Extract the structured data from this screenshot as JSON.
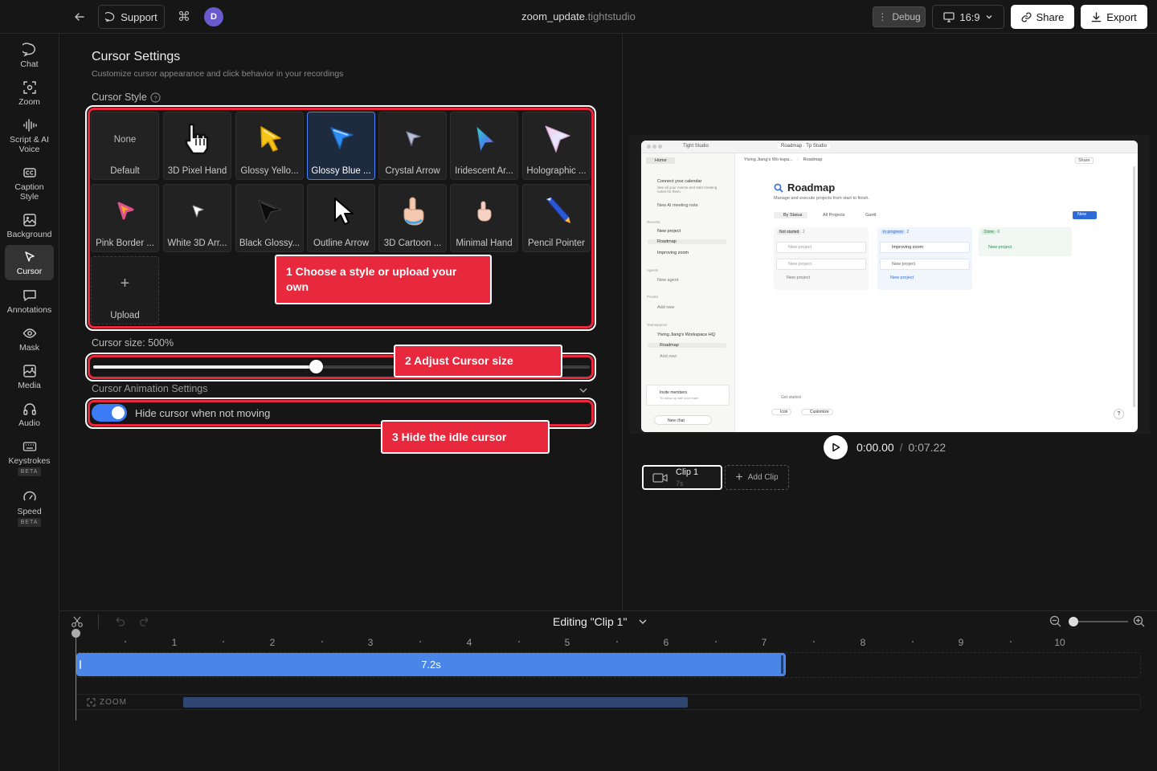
{
  "topbar": {
    "support_label": "Support",
    "avatar_letter": "D",
    "file_name": "zoom_update",
    "file_ext": ".tightstudio",
    "debug_label": "Debug",
    "ratio_label": "16:9",
    "share_label": "Share",
    "export_label": "Export"
  },
  "sidebar": {
    "items": [
      {
        "label": "Chat",
        "icon": "chat-bubble-icon"
      },
      {
        "label": "Zoom",
        "icon": "zoom-frame-icon"
      },
      {
        "label": "Script & AI Voice",
        "icon": "waveform-icon"
      },
      {
        "label": "Caption Style",
        "icon": "caption-icon"
      },
      {
        "label": "Background",
        "icon": "image-icon"
      },
      {
        "label": "Cursor",
        "icon": "cursor-icon",
        "active": true
      },
      {
        "label": "Annotations",
        "icon": "annotation-icon"
      },
      {
        "label": "Mask",
        "icon": "eye-icon"
      },
      {
        "label": "Media",
        "icon": "media-icon"
      },
      {
        "label": "Audio",
        "icon": "headphones-icon"
      },
      {
        "label": "Keystrokes",
        "icon": "keyboard-icon",
        "badge": "BETA"
      },
      {
        "label": "Speed",
        "icon": "gauge-icon",
        "badge": "BETA"
      }
    ]
  },
  "cursor_settings": {
    "title": "Cursor Settings",
    "subtitle": "Customize cursor appearance and click behavior in your recordings",
    "style_label": "Cursor Style",
    "none_text": "None",
    "styles": [
      {
        "label": "Default"
      },
      {
        "label": "3D Pixel Hand"
      },
      {
        "label": "Glossy Yello..."
      },
      {
        "label": "Glossy Blue ...",
        "selected": true
      },
      {
        "label": "Crystal Arrow"
      },
      {
        "label": "Iridescent Ar..."
      },
      {
        "label": "Holographic ..."
      },
      {
        "label": "Pink Border ..."
      },
      {
        "label": "White 3D Arr..."
      },
      {
        "label": "Black Glossy..."
      },
      {
        "label": "Outline Arrow"
      },
      {
        "label": "3D Cartoon ..."
      },
      {
        "label": "Minimal Hand"
      },
      {
        "label": "Pencil Pointer"
      },
      {
        "label": "Upload"
      }
    ],
    "size_label": "Cursor size: 500%",
    "size_fraction": 0.448,
    "animation_label": "Cursor Animation Settings",
    "hide_toggle_label": "Hide cursor when not moving",
    "hide_toggle_on": true
  },
  "callouts": {
    "c1": "1 Choose a style or upload your own",
    "c2": "2 Adjust Cursor size",
    "c3": "3 Hide the idle cursor"
  },
  "preview": {
    "app_name": "Tight Studio",
    "home_label": "Home",
    "tab_roadmap": "Roadmap · Tp Studio",
    "breadcrumb_ws": "Yiving Jiang's Wo kspa...",
    "breadcrumb_page": "Roadmap",
    "share_label": "Share",
    "calendar_title": "Connect your calendar",
    "calendar_desc": "See all your events and start meeting notes for them.",
    "new_meeting": "New AI meeting note",
    "recents_label": "Recents",
    "recents": [
      "New project",
      "Roadmap",
      "Improving zoom"
    ],
    "agents_label": "Agents",
    "new_agent": "New agent",
    "private_label": "Private",
    "add_new": "Add new",
    "teamspaces_label": "Teamspaces",
    "workspace_hq": "Yiving Jiang's Workspace HQ",
    "teamspace_roadmap": "Roadmap",
    "teamspace_add": "Add new",
    "invite_title": "Invite members",
    "invite_desc": "To follow up with your team",
    "new_chat": "New chat",
    "page_title": "Roadmap",
    "page_desc": "Manage and execute projects from start to finish.",
    "view_by_status": "By Status",
    "view_all": "All Projects",
    "view_gantt": "Gantt",
    "new_button": "New",
    "columns": [
      {
        "name": "Not started",
        "count": "2",
        "cards": [
          "New project",
          "New project"
        ],
        "add": "New project"
      },
      {
        "name": "In progress",
        "count": "2",
        "cards": [
          "Improving zoom",
          "New project"
        ],
        "add": "New project"
      },
      {
        "name": "Done",
        "count": "0",
        "cards": [],
        "add": "New project"
      }
    ],
    "get_started": "Get started",
    "footer_left": "Icon",
    "footer_right": "Customize"
  },
  "player": {
    "current_time": "0:00.00",
    "separator": "/",
    "total_time": "0:07.22",
    "clip_name": "Clip 1",
    "clip_duration": "7s",
    "add_clip_label": "Add Clip"
  },
  "timeline": {
    "editing_label": "Editing \"Clip 1\"",
    "ticks": [
      "1",
      "2",
      "3",
      "4",
      "5",
      "6",
      "7",
      "8",
      "9",
      "10"
    ],
    "clip_length_label": "7.2s",
    "zoom_track_label": "ZOOM",
    "zoom_level_fraction": 0.0
  },
  "colors": {
    "accent_blue": "#4a83ff",
    "clip_blue": "#4a86e8",
    "callout_red": "#e8283d",
    "zoom_segment": "#2f4670"
  }
}
